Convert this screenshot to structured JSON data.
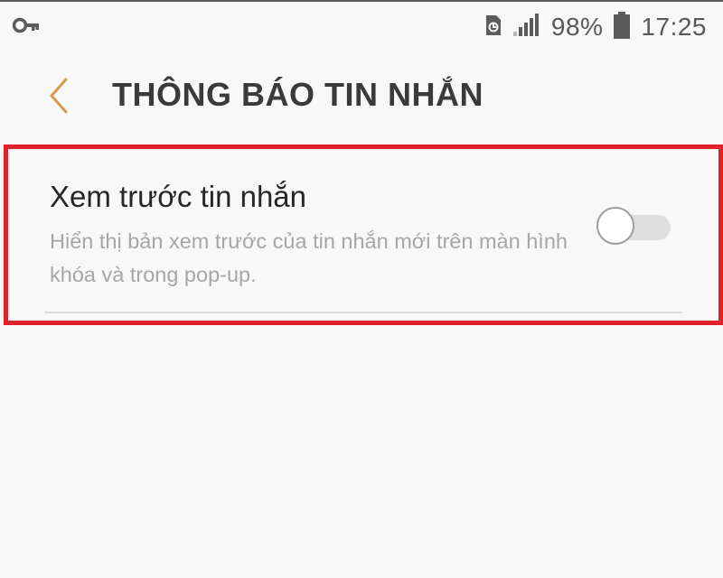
{
  "status_bar": {
    "left_icon": "key-icon",
    "right_icons": [
      "sim-card-icon",
      "signal-icon",
      "battery-icon"
    ],
    "battery_percent": "98%",
    "time": "17:25"
  },
  "header": {
    "back_icon": "chevron-left-icon",
    "title": "THÔNG BÁO TIN NHẮN"
  },
  "setting": {
    "title": "Xem trước tin nhắn",
    "description": "Hiển thị bản xem trước của tin nhắn mới trên màn hình khóa và trong pop-up.",
    "toggle_on": false
  },
  "colors": {
    "accent": "#d89a4e",
    "highlight": "#e0202a",
    "background": "#f8f8f8"
  }
}
